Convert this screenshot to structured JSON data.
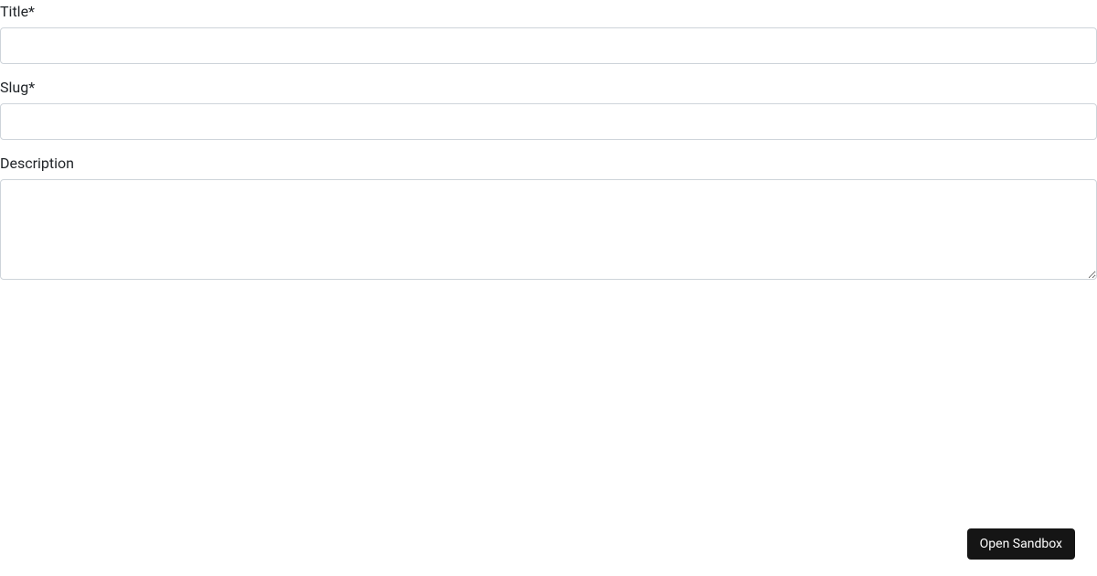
{
  "form": {
    "title": {
      "label": "Title*",
      "value": ""
    },
    "slug": {
      "label": "Slug*",
      "value": ""
    },
    "description": {
      "label": "Description",
      "value": ""
    }
  },
  "sandbox_button": {
    "label": "Open Sandbox"
  }
}
